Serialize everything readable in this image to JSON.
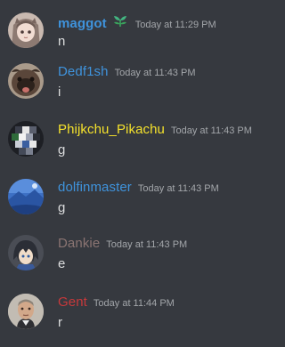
{
  "messages": [
    {
      "username": "maggot",
      "name_color": "#3f93dc",
      "badge": "plant-sprout-icon",
      "timestamp": "Today at 11:29 PM",
      "content": "n",
      "avatar": "anime-girl-avatar"
    },
    {
      "username": "Dedf1sh",
      "name_color": "#3f93dc",
      "timestamp": "Today at 11:43 PM",
      "content": "i",
      "avatar": "pug-dog-avatar"
    },
    {
      "username": "Phijkchu_Pikachu",
      "name_color": "#f5e22c",
      "timestamp": "Today at 11:43 PM",
      "content": "g",
      "avatar": "pixel-art-avatar"
    },
    {
      "username": "dolfinmaster",
      "name_color": "#3f93dc",
      "timestamp": "Today at 11:43 PM",
      "content": "g",
      "avatar": "blue-landscape-avatar"
    },
    {
      "username": "Dankie",
      "name_color": "#8a7472",
      "timestamp": "Today at 11:43 PM",
      "content": "e",
      "avatar": "anime-boy-avatar"
    },
    {
      "username": "Gent",
      "name_color": "#c7393b",
      "timestamp": "Today at 11:44 PM",
      "content": "r",
      "avatar": "man-face-avatar"
    }
  ]
}
